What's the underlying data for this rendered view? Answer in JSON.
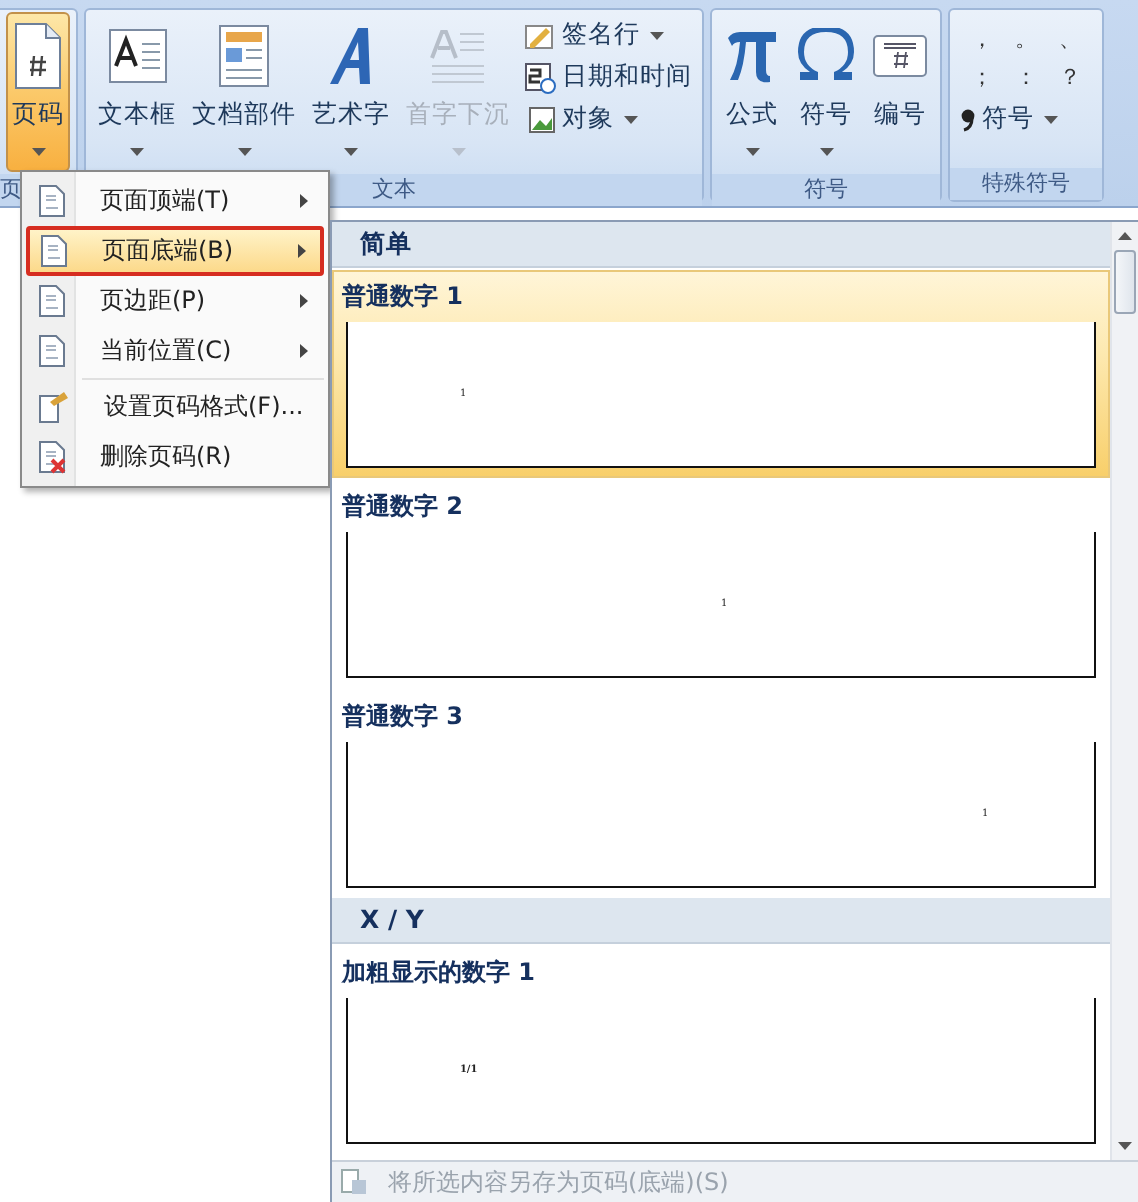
{
  "ribbon": {
    "groups": [
      {
        "label": "页",
        "large_buttons": [
          {
            "label": "页码",
            "dropdown": true,
            "selected": true,
            "disabled": false
          }
        ]
      },
      {
        "label": "文本",
        "large_buttons": [
          {
            "label": "文本框",
            "dropdown": true,
            "selected": false,
            "disabled": false
          },
          {
            "label": "文档部件",
            "dropdown": true,
            "selected": false,
            "disabled": false
          },
          {
            "label": "艺术字",
            "dropdown": true,
            "selected": false,
            "disabled": false
          },
          {
            "label": "首字下沉",
            "dropdown": true,
            "selected": false,
            "disabled": true
          }
        ],
        "small_buttons": [
          {
            "label": "签名行",
            "dropdown": true
          },
          {
            "label": "日期和时间",
            "dropdown": false
          },
          {
            "label": "对象",
            "dropdown": true
          }
        ]
      },
      {
        "label": "符号",
        "large_buttons": [
          {
            "label": "公式",
            "dropdown": true,
            "selected": false,
            "disabled": false
          },
          {
            "label": "符号",
            "dropdown": true,
            "selected": false,
            "disabled": false
          },
          {
            "label": "编号",
            "dropdown": false,
            "selected": false,
            "disabled": false
          }
        ]
      },
      {
        "label": "特殊符号",
        "symbols": [
          "，",
          "。",
          "、",
          "；",
          "：",
          "？"
        ],
        "small_buttons": [
          {
            "label": "符号",
            "dropdown": true
          }
        ]
      }
    ]
  },
  "menu": {
    "items": [
      {
        "label": "页面顶端(T)",
        "submenu": true,
        "selected": false,
        "separator_before": false
      },
      {
        "label": "页面底端(B)",
        "submenu": true,
        "selected": true,
        "separator_before": false
      },
      {
        "label": "页边距(P)",
        "submenu": true,
        "selected": false,
        "separator_before": false
      },
      {
        "label": "当前位置(C)",
        "submenu": true,
        "selected": false,
        "separator_before": false
      },
      {
        "label": "设置页码格式(F)...",
        "submenu": false,
        "selected": false,
        "separator_before": true
      },
      {
        "label": "删除页码(R)",
        "submenu": false,
        "selected": false,
        "separator_before": false
      }
    ]
  },
  "gallery": {
    "sections": [
      {
        "title": "简单",
        "items": [
          {
            "label": "普通数字 1",
            "page_number": "1",
            "kind": "left",
            "bold": false,
            "selected": true
          },
          {
            "label": "普通数字 2",
            "page_number": "1",
            "kind": "center",
            "bold": false,
            "selected": false
          },
          {
            "label": "普通数字 3",
            "page_number": "1",
            "kind": "right",
            "bold": false,
            "selected": false
          }
        ]
      },
      {
        "title": "X / Y",
        "items": [
          {
            "label": "加粗显示的数字 1",
            "page_number": "1/1",
            "kind": "left",
            "bold": true,
            "selected": false
          }
        ]
      }
    ],
    "footer": {
      "label": "将所选内容另存为页码(底端)(S)",
      "disabled": true
    }
  }
}
